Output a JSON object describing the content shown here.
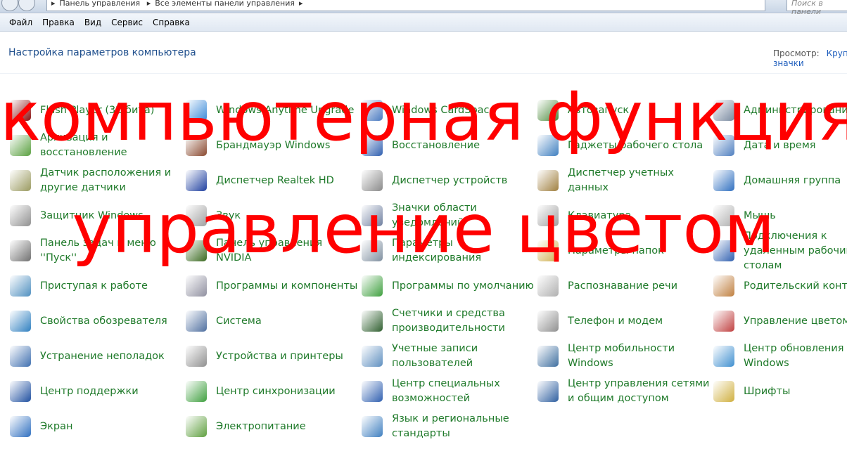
{
  "address": {
    "crumbs": [
      "Панель управления",
      "Все элементы панели управления"
    ],
    "search_placeholder": "Поиск в панели"
  },
  "menu": [
    "Файл",
    "Правка",
    "Вид",
    "Сервис",
    "Справка"
  ],
  "heading": "Настройка параметров компьютера",
  "view": {
    "label": "Просмотр:",
    "value": "Крупные значки"
  },
  "items": [
    {
      "label": "Flash Player (32 бита)",
      "color": "#8b1010"
    },
    {
      "label": "Windows Anytime Upgrade",
      "color": "#3a8ad8"
    },
    {
      "label": "Windows CardSpace",
      "color": "#4a7ac0"
    },
    {
      "label": "Автозапуск",
      "color": "#4a8a3a"
    },
    {
      "label": "Администрирование",
      "color": "#7a8aa0"
    },
    {
      "label": "Архивация и восстановление",
      "color": "#5aa040"
    },
    {
      "label": "Брандмауэр Windows",
      "color": "#8a4a30"
    },
    {
      "label": "Восстановление",
      "color": "#3060b0"
    },
    {
      "label": "Гаджеты рабочего стола",
      "color": "#4080c0"
    },
    {
      "label": "Дата и время",
      "color": "#5080c0"
    },
    {
      "label": "Датчик расположения и другие датчики",
      "color": "#9a9a60"
    },
    {
      "label": "Диспетчер Realtek HD",
      "color": "#2040a0"
    },
    {
      "label": "Диспетчер устройств",
      "color": "#8a8a8a"
    },
    {
      "label": "Диспетчер учетных данных",
      "color": "#a08040"
    },
    {
      "label": "Домашняя группа",
      "color": "#3070c0"
    },
    {
      "label": "Защитник Windows",
      "color": "#909090"
    },
    {
      "label": "Звук",
      "color": "#a0a0a0"
    },
    {
      "label": "Значки области уведомлений",
      "color": "#7080a0"
    },
    {
      "label": "Клавиатура",
      "color": "#a0a0a0"
    },
    {
      "label": "Мышь",
      "color": "#b0b0b0"
    },
    {
      "label": "Панель задач и меню ''Пуск''",
      "color": "#707070"
    },
    {
      "label": "Панель управления NVIDIA",
      "color": "#3a6a20"
    },
    {
      "label": "Параметры индексирования",
      "color": "#8090a0"
    },
    {
      "label": "Параметры папок",
      "color": "#d0b050"
    },
    {
      "label": "Подключения к удаленным рабочим столам",
      "color": "#3060b0"
    },
    {
      "label": "Приступая к работе",
      "color": "#5090c0"
    },
    {
      "label": "Программы и компоненты",
      "color": "#9090a0"
    },
    {
      "label": "Программы по умолчанию",
      "color": "#40a040"
    },
    {
      "label": "Распознавание речи",
      "color": "#b0b0b0"
    },
    {
      "label": "Родительский контроль",
      "color": "#c08040"
    },
    {
      "label": "Свойства обозревателя",
      "color": "#3080c0"
    },
    {
      "label": "Система",
      "color": "#5070a0"
    },
    {
      "label": "Счетчики и средства производительности",
      "color": "#306030"
    },
    {
      "label": "Телефон и модем",
      "color": "#909090"
    },
    {
      "label": "Управление цветом",
      "color": "#c04040"
    },
    {
      "label": "Устранение неполадок",
      "color": "#4070b0"
    },
    {
      "label": "Устройства и принтеры",
      "color": "#909090"
    },
    {
      "label": "Учетные записи пользователей",
      "color": "#6090c0"
    },
    {
      "label": "Центр мобильности Windows",
      "color": "#4070a0"
    },
    {
      "label": "Центр обновления Windows",
      "color": "#4090d0"
    },
    {
      "label": "Центр поддержки",
      "color": "#2050a0"
    },
    {
      "label": "Центр синхронизации",
      "color": "#40a040"
    },
    {
      "label": "Центр специальных возможностей",
      "color": "#3060b0"
    },
    {
      "label": "Центр управления сетями и общим доступом",
      "color": "#3060a0"
    },
    {
      "label": "Шрифты",
      "color": "#d0b040"
    },
    {
      "label": "Экран",
      "color": "#3070c0"
    },
    {
      "label": "Электропитание",
      "color": "#60a040"
    },
    {
      "label": "Язык и региональные стандарты",
      "color": "#4080c0"
    }
  ],
  "overlay": {
    "line1": "компьютерная функция",
    "line2": "управление цветом"
  }
}
